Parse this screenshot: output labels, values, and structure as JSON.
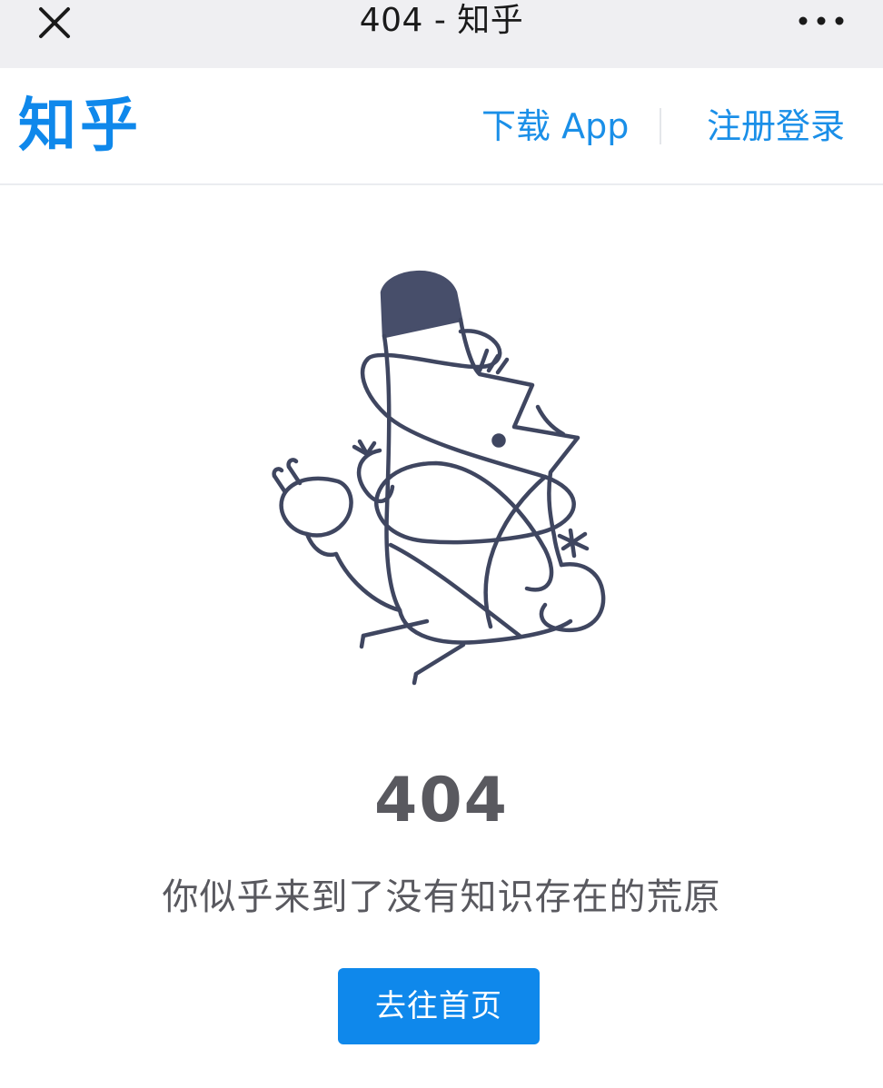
{
  "window": {
    "title": "404 - 知乎",
    "close_icon": "close-icon",
    "more_icon": "more-icon"
  },
  "header": {
    "logo": "知乎",
    "download_label": "下载 App",
    "login_label": "注册登录"
  },
  "error": {
    "code": "404",
    "message": "你似乎来到了没有知识存在的荒原",
    "home_button_label": "去往首页"
  },
  "colors": {
    "brand": "#0f88eb",
    "text_gray": "#59595f",
    "illustration_stroke": "#3f4660"
  }
}
